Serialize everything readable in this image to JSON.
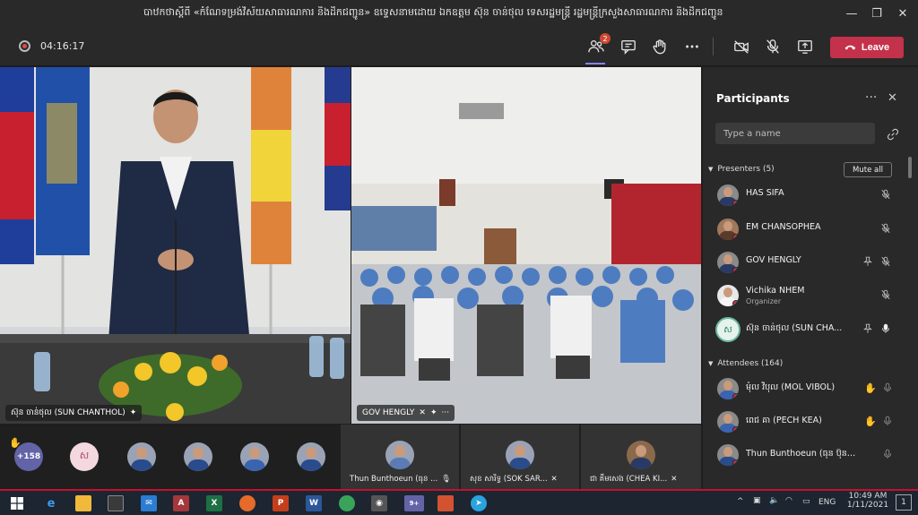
{
  "window": {
    "title": "បាឋកថាស្ដីពី «កំណែទម្រង់វិស័យសាធារណការ និងដឹកជញ្ជូន» ឧទ្ទេសនាមដោយ ឯកឧត្តម ស៊ុន ចាន់ថុល ទេសរដ្ឋមន្ត្រី រដ្ឋមន្ត្រីក្រសួងសាធារណការ និងដឹកជញ្ជូន",
    "minimize": "—",
    "maximize": "❐",
    "close": "✕"
  },
  "controls": {
    "timer": "04:16:17",
    "participants_badge": "2",
    "leave_label": "Leave"
  },
  "video": {
    "left_name": "ស៊ុន ចាន់ថុល (SUN CHANTHOL)",
    "right_name": "GOV HENGLY",
    "right_more": "···"
  },
  "panel": {
    "title": "Participants",
    "more": "···",
    "close": "✕",
    "search_placeholder": "Type a name",
    "presenters_header": "Presenters (5)",
    "mute_all_label": "Mute all",
    "attendees_header": "Attendees (164)",
    "presenters": [
      {
        "name": "HAS SIFA",
        "role": ""
      },
      {
        "name": "EM CHANSOPHEA",
        "role": ""
      },
      {
        "name": "GOV HENGLY",
        "role": ""
      },
      {
        "name": "Vichika NHEM",
        "role": "Organizer"
      },
      {
        "name": "ស៊ុន ចាន់ថុល (SUN CHA...",
        "role": "",
        "initial": "ស"
      }
    ],
    "attendees": [
      {
        "name": "ម៉ុល វិបុល (MOL VIBOL)"
      },
      {
        "name": "ពេជ គា (PECH KEA)"
      },
      {
        "name": "Thun Bunthoeun (ធុន ប៊ុនធឿ..."
      }
    ]
  },
  "gallery": {
    "overflow_count": "+158",
    "initial_avatar": "ស",
    "named": [
      {
        "name": "Thun Bunthoeun (ធុន ..."
      },
      {
        "name": "សុខ សារិទ្ធ (SOK SAR..."
      },
      {
        "name": "ជា គឹមសេង (CHEA KI..."
      }
    ]
  },
  "taskbar": {
    "lang": "ENG",
    "time": "10:49 AM",
    "date": "1/11/2021",
    "teams_badge": "9+",
    "notif_count": "1"
  },
  "colors": {
    "leave": "#c4314b",
    "accent": "#7f85f5",
    "panel_bg": "#292929",
    "raise_hand": "#f1c232"
  }
}
